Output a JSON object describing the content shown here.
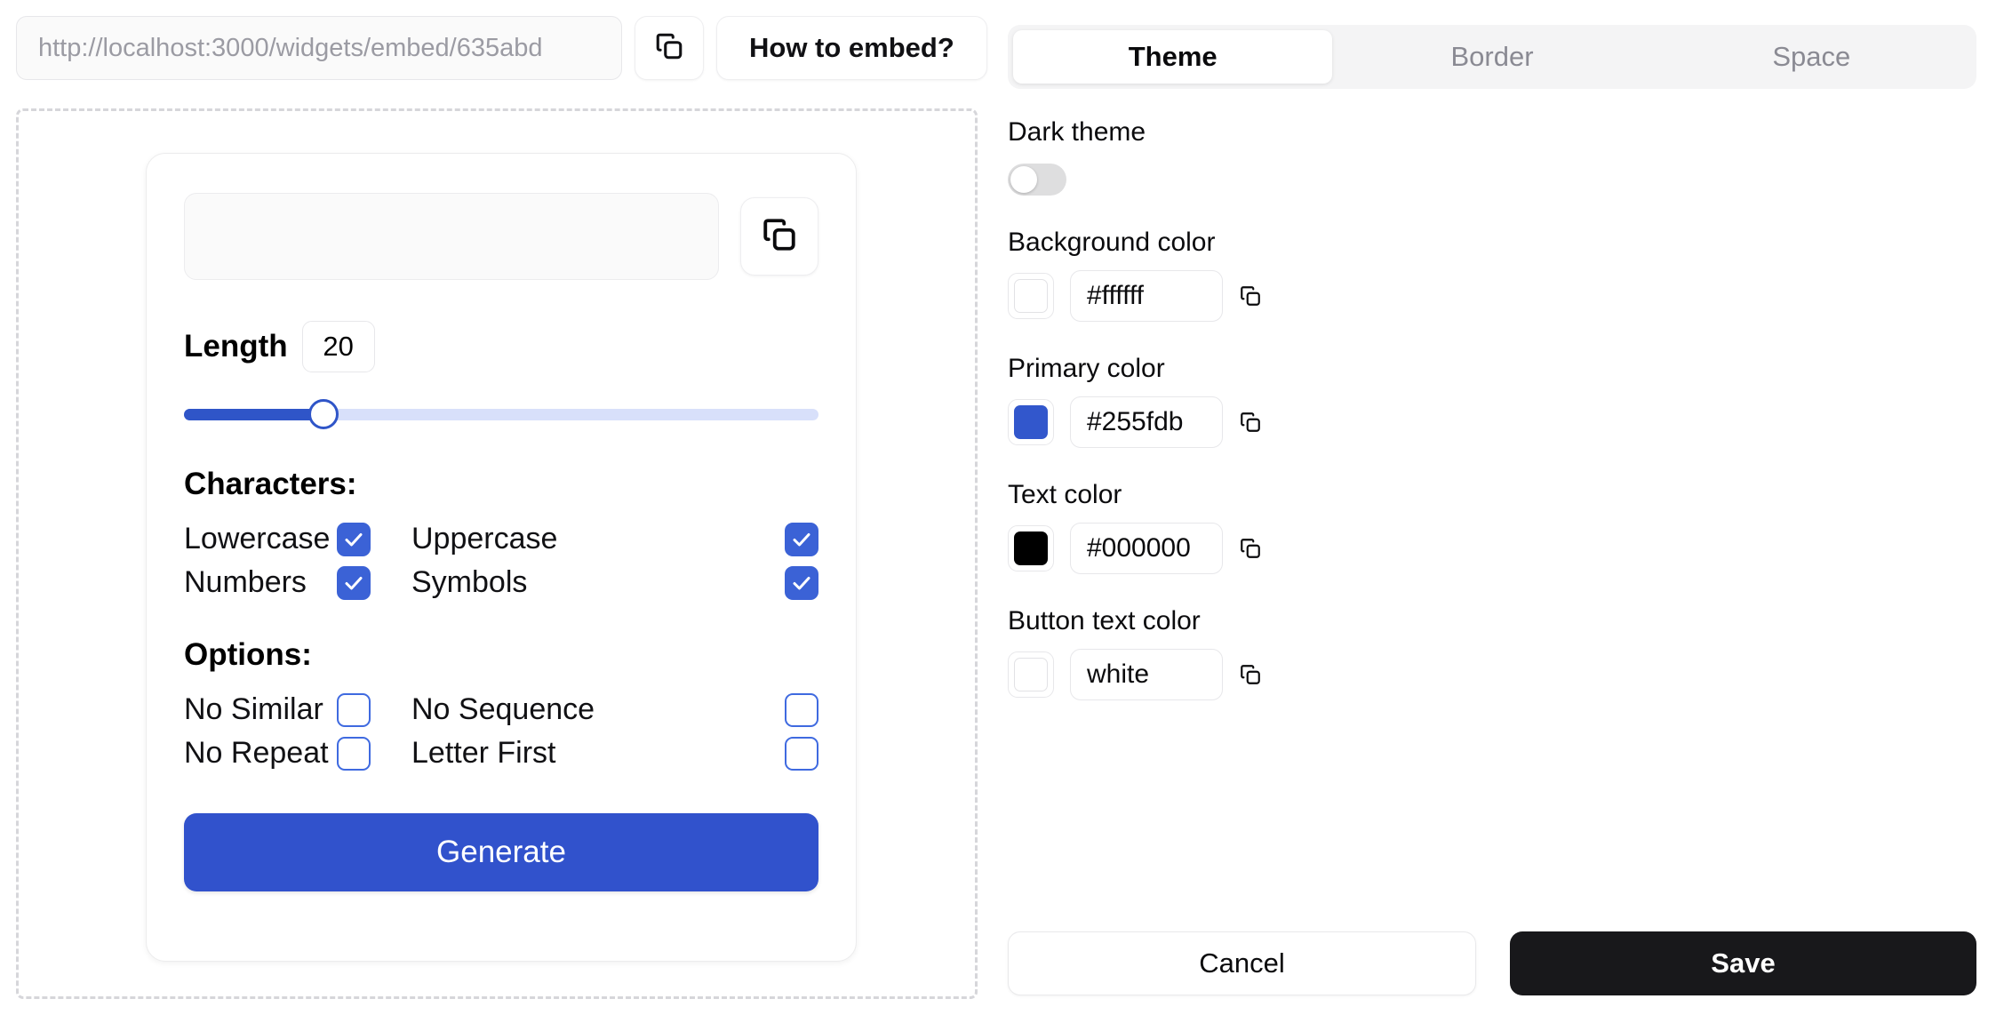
{
  "embed": {
    "url_placeholder": "http://localhost:3000/widgets/embed/635abd",
    "url_value": "",
    "copy_icon": "copy-icon",
    "how_to_embed_label": "How to embed?"
  },
  "widget": {
    "password_value": "",
    "password_placeholder": "",
    "copy_icon": "copy-icon",
    "length_label": "Length",
    "length_value": "20",
    "slider": {
      "value": 20,
      "min": 4,
      "max": 80,
      "percent": 22
    },
    "characters_title": "Characters:",
    "characters": [
      {
        "label": "Lowercase",
        "checked": true
      },
      {
        "label": "Uppercase",
        "checked": true
      },
      {
        "label": "Numbers",
        "checked": true
      },
      {
        "label": "Symbols",
        "checked": true
      }
    ],
    "options_title": "Options:",
    "options": [
      {
        "label": "No Similar",
        "checked": false
      },
      {
        "label": "No Sequence",
        "checked": false
      },
      {
        "label": "No Repeat",
        "checked": false
      },
      {
        "label": "Letter First",
        "checked": false
      }
    ],
    "generate_label": "Generate",
    "colors": {
      "primary": "#3152cc",
      "checkbox_on": "#3b62d6",
      "checkbox_border": "#3f6ae0",
      "slider_fill": "#2f55c8",
      "slider_track": "#d8e0fa"
    }
  },
  "panel": {
    "tabs": [
      {
        "label": "Theme",
        "active": true
      },
      {
        "label": "Border",
        "active": false
      },
      {
        "label": "Space",
        "active": false
      }
    ],
    "dark_theme": {
      "label": "Dark theme",
      "enabled": false
    },
    "colors": [
      {
        "label": "Background color",
        "value": "#ffffff",
        "swatch": "#ffffff",
        "copy_icon": "copy-icon"
      },
      {
        "label": "Primary color",
        "value": "#255fdb",
        "swatch": "#3257cc",
        "copy_icon": "copy-icon"
      },
      {
        "label": "Text color",
        "value": "#000000",
        "swatch": "#000000",
        "copy_icon": "copy-icon"
      },
      {
        "label": "Button text color",
        "value": "white",
        "swatch": "#ffffff",
        "copy_icon": "copy-icon"
      }
    ],
    "cancel_label": "Cancel",
    "save_label": "Save"
  }
}
